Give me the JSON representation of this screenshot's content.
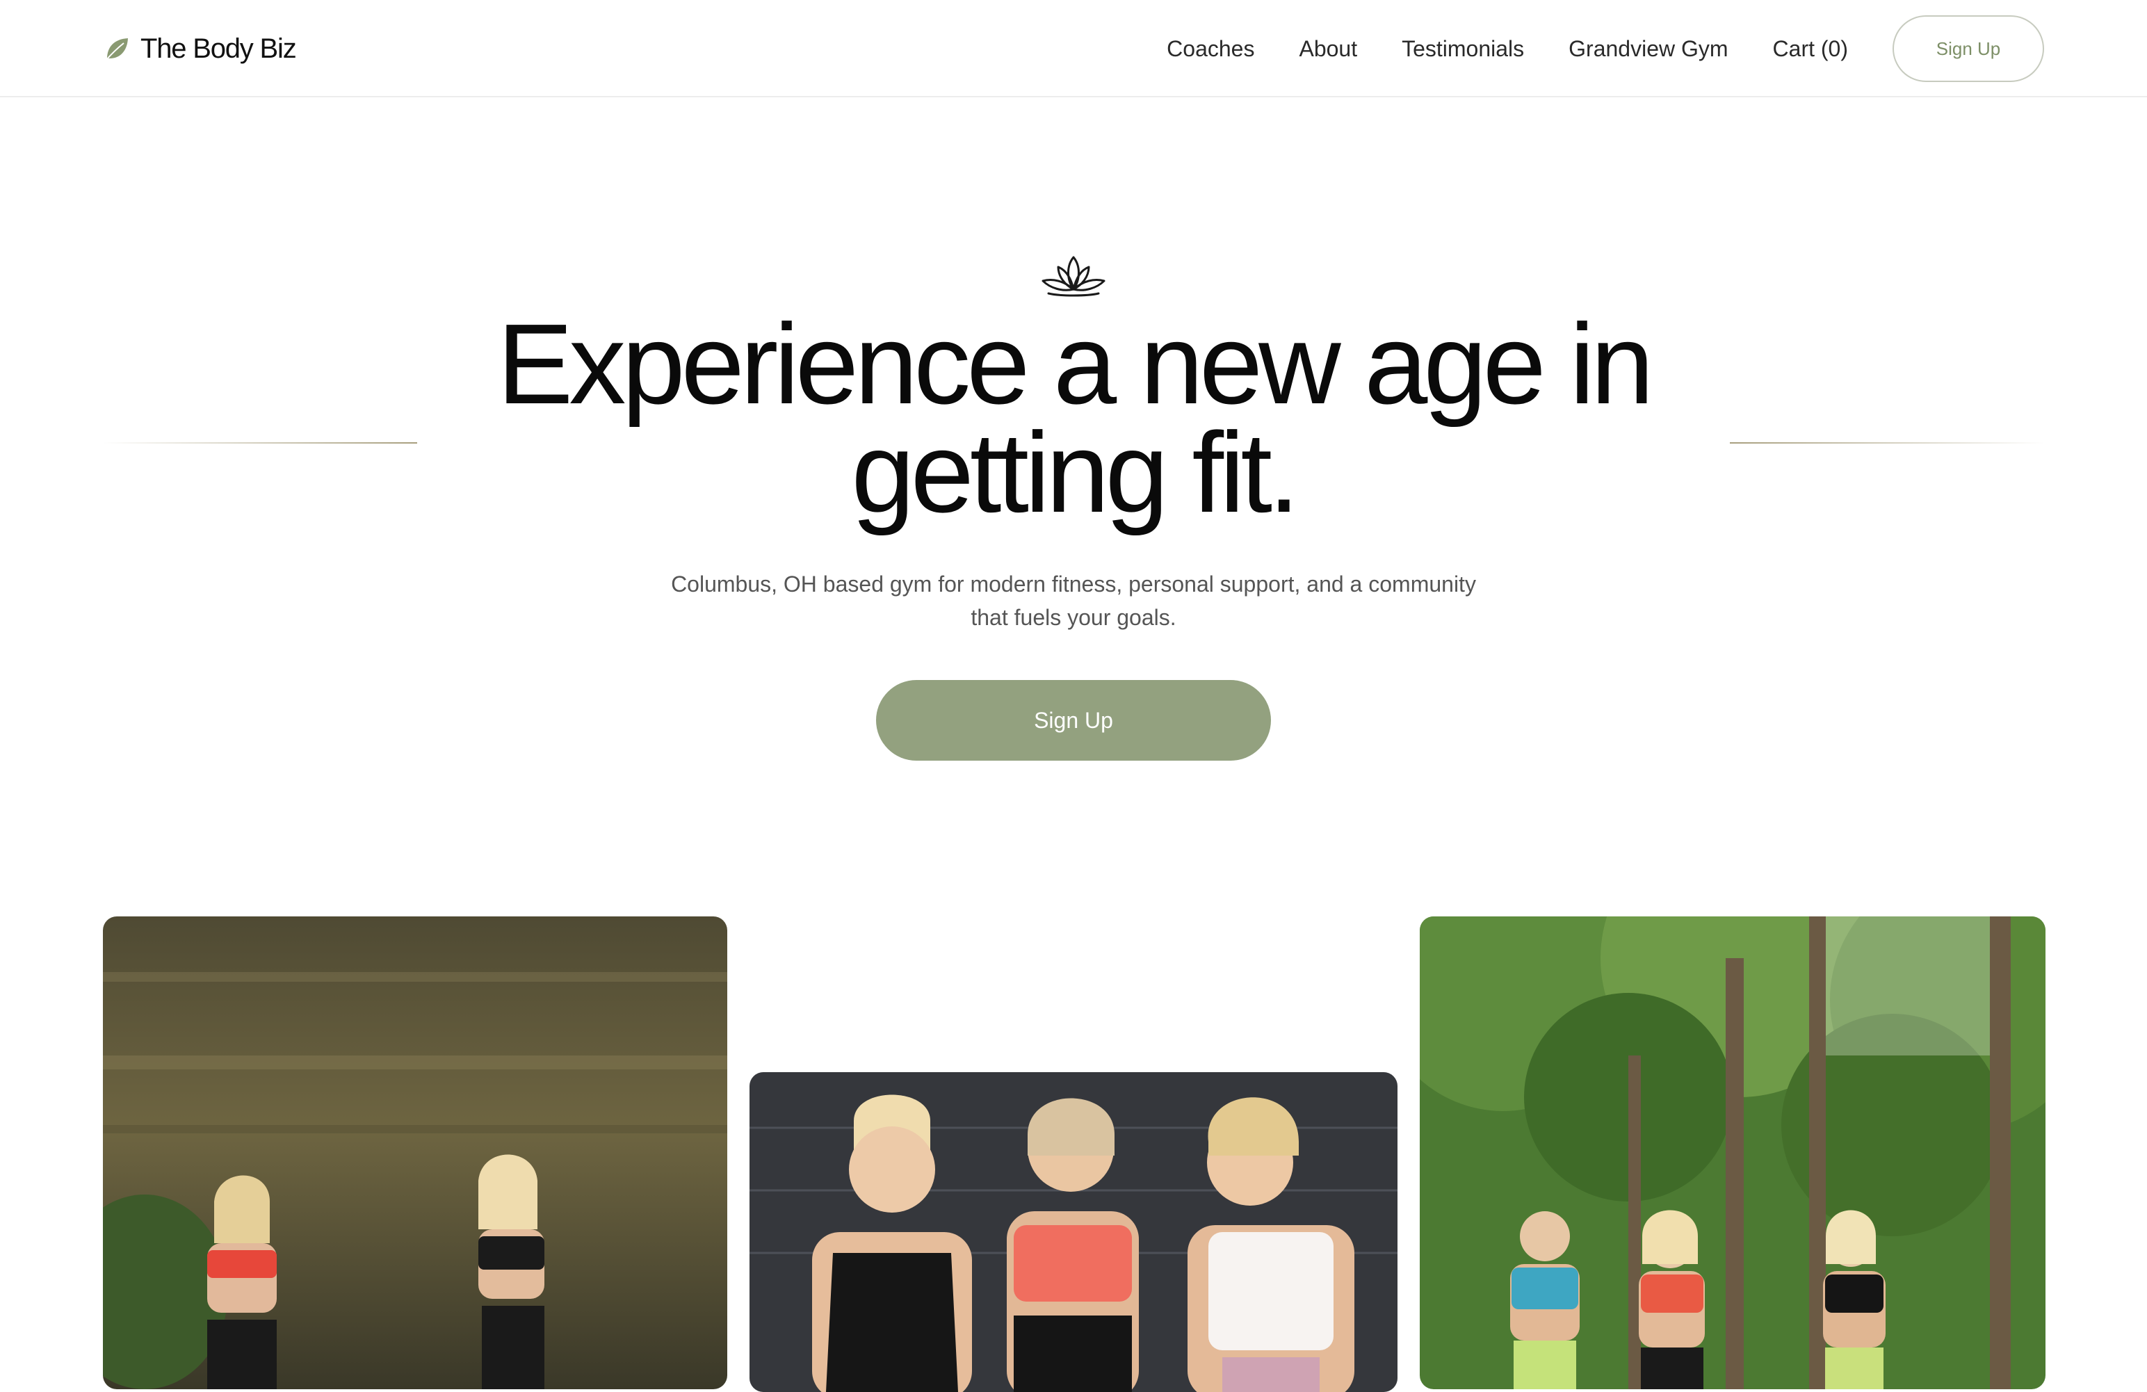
{
  "brand": {
    "name": "The Body Biz",
    "logo_icon": "leaf-icon",
    "accent_color": "#93a17f"
  },
  "nav": {
    "links": [
      {
        "label": "Coaches"
      },
      {
        "label": "About"
      },
      {
        "label": "Testimonials"
      },
      {
        "label": "Grandview Gym"
      },
      {
        "label": "Cart (0)"
      }
    ],
    "signup_label": "Sign Up"
  },
  "hero": {
    "icon": "lotus-icon",
    "title": "Experience a new age in getting fit.",
    "subtitle": "Columbus, OH based gym for modern fitness, personal support, and a community that fuels your goals.",
    "cta_label": "Sign Up"
  },
  "photos": [
    {
      "name": "coaches-rock-wall-photo"
    },
    {
      "name": "coaches-smiling-photo"
    },
    {
      "name": "coaches-forest-photo"
    }
  ]
}
